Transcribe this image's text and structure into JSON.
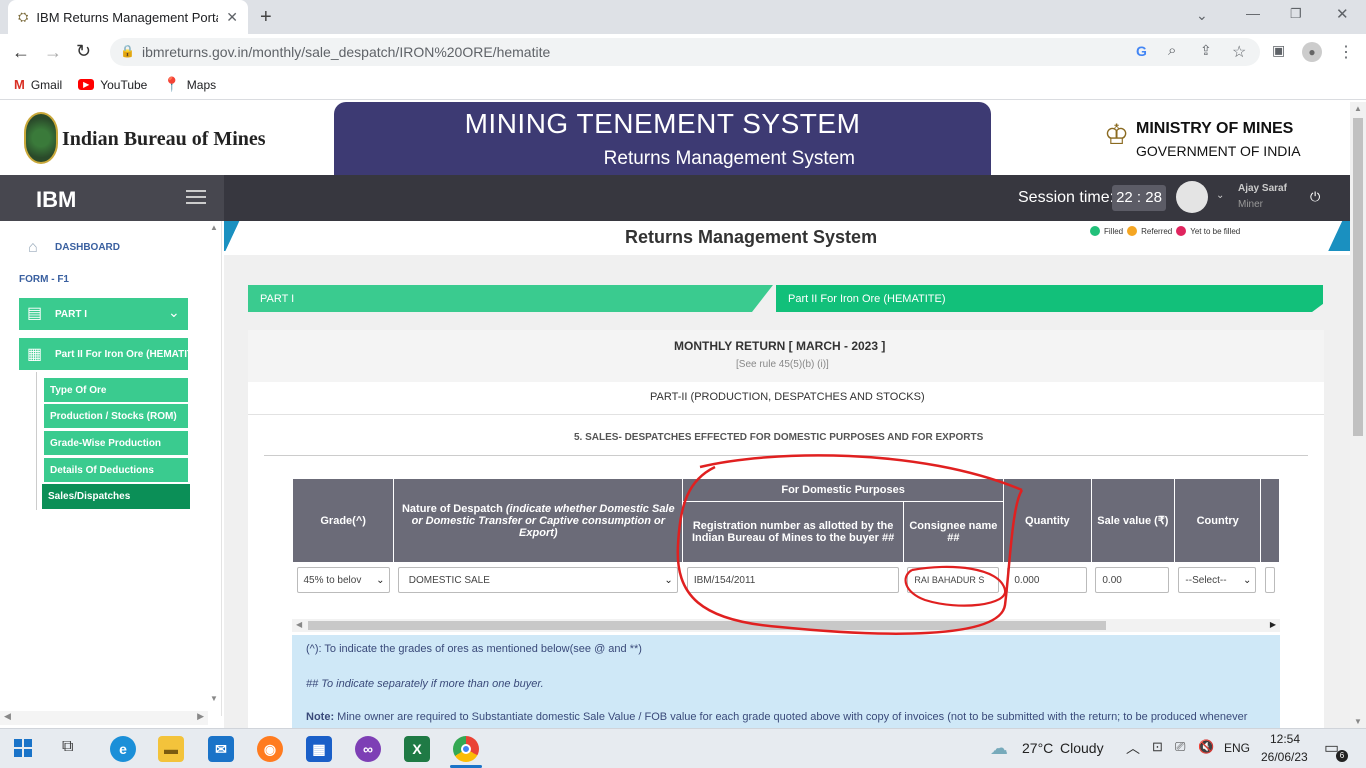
{
  "browser": {
    "tab_title": "IBM Returns Management Portal",
    "url": "ibmreturns.gov.in/monthly/sale_despatch/IRON%20ORE/hematite",
    "bookmarks": [
      "Gmail",
      "YouTube",
      "Maps"
    ]
  },
  "header": {
    "logo_text": "Indian Bureau of Mines",
    "title": "MINING TENEMENT SYSTEM",
    "subtitle": "Returns Management System",
    "ministry_line1": "MINISTRY OF MINES",
    "ministry_line2": "GOVERNMENT OF INDIA"
  },
  "navbar": {
    "brand": "IBM",
    "session_label": "Session time:",
    "session_time": "22 : 28",
    "user_name": "Ajay Saraf",
    "user_role": "Miner"
  },
  "sidebar": {
    "dashboard": "DASHBOARD",
    "form": "FORM - F1",
    "part1": "PART I",
    "part2": "Part II For Iron Ore (HEMATITE)",
    "subitems": [
      "Type Of Ore",
      "Production / Stocks (ROM)",
      "Grade-Wise Production",
      "Details Of Deductions",
      "Sales/Dispatches"
    ]
  },
  "main": {
    "title": "Returns Management System",
    "legend": [
      "Filled",
      "Referred",
      "Yet to be filled"
    ],
    "tab_part1": "PART I",
    "tab_part2": "Part II For Iron Ore (HEMATITE)",
    "return_title": "MONTHLY RETURN [ MARCH - 2023 ]",
    "return_rule": "[See rule 45(5)(b) (i)]",
    "part_heading": "PART-II (PRODUCTION, DESPATCHES AND STOCKS)",
    "section_heading": "5. SALES- DESPATCHES EFFECTED FOR DOMESTIC PURPOSES AND FOR EXPORTS"
  },
  "table": {
    "group_header": "For Domestic Purposes",
    "col_grade": "Grade(^)",
    "col_nature": "Nature of Despatch",
    "col_nature_italic": "(indicate whether Domestic Sale or Domestic Transfer or Captive consumption or Export)",
    "col_reg": "Registration number as allotted by the Indian Bureau of Mines to the buyer ##",
    "col_consignee": "Consignee name ##",
    "col_qty": "Quantity",
    "col_sale": "Sale value (₹)",
    "col_country": "Country",
    "row": {
      "grade": "45% to belov",
      "nature": "DOMESTIC SALE",
      "reg": "IBM/154/2011",
      "consignee": "RAI BAHADUR S",
      "qty": "0.000",
      "sale": "0.00",
      "country": "--Select--"
    }
  },
  "notes": {
    "n1": "(^): To indicate the grades of ores as mentioned below(see @ and **)",
    "n2": "## To indicate separately if more than one buyer.",
    "n3_label": "Note:",
    "n3": "Mine owner are required to Substantiate domestic Sale Value / FOB value for each grade quoted above with copy of invoices (not to be submitted with the return; to be produced whenever"
  },
  "taskbar": {
    "temp": "27°C",
    "weather": "Cloudy",
    "lang": "ENG",
    "time": "12:54",
    "date": "26/06/23",
    "notif_count": "6"
  },
  "colors": {
    "green": "#3acb8f",
    "green_dark": "#0b8f57",
    "banner": "#3d3a73",
    "navbar": "#37373f",
    "annotation_red": "#e02020"
  }
}
